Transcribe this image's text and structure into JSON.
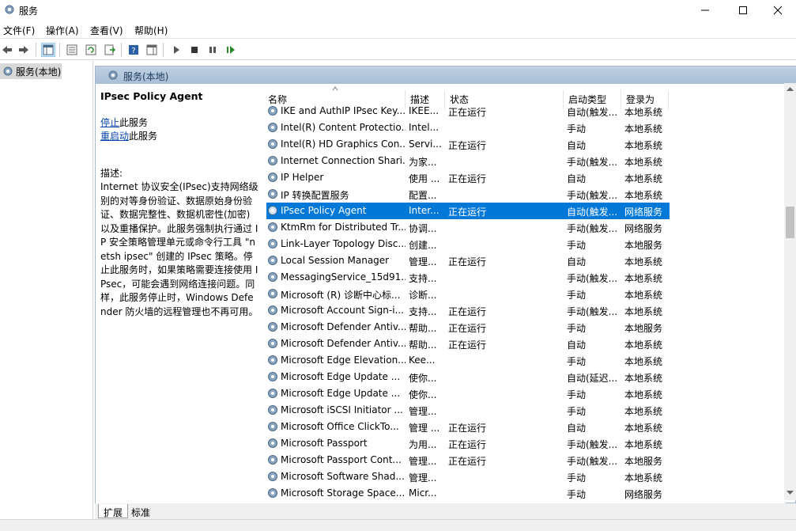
{
  "window": {
    "title": "服务"
  },
  "menu": [
    "文件(F)",
    "操作(A)",
    "查看(V)",
    "帮助(H)"
  ],
  "tree": {
    "item": "服务(本地)"
  },
  "header": {
    "title": "服务(本地)"
  },
  "description": {
    "service_name": "IPsec Policy Agent",
    "stop_link": "停止",
    "stop_suffix": "此服务",
    "restart_link": "重启动",
    "restart_suffix": "此服务",
    "desc_label": "描述:",
    "desc_text": "Internet 协议安全(IPsec)支持网络级别的对等身份验证、数据原始身份验证、数据完整性、数据机密性(加密)以及重播保护。此服务强制执行通过 IP 安全策略管理单元或命令行工具 \"netsh ipsec\" 创建的 IPsec 策略。停止此服务时，如果策略需要连接使用 IPsec，可能会遇到网络连接问题。同样，此服务停止时，Windows Defender 防火墙的远程管理也不再可用。"
  },
  "columns": [
    "名称",
    "描述",
    "状态",
    "启动类型",
    "登录为"
  ],
  "rows": [
    {
      "name": "IKE and AuthIP IPsec Key...",
      "desc": "IKEE...",
      "status": "正在运行",
      "startup": "自动(触发...",
      "logon": "本地系统"
    },
    {
      "name": "Intel(R) Content Protectio...",
      "desc": "Intel...",
      "status": "",
      "startup": "手动",
      "logon": "本地系统"
    },
    {
      "name": "Intel(R) HD Graphics Con...",
      "desc": "Servi...",
      "status": "正在运行",
      "startup": "自动",
      "logon": "本地系统"
    },
    {
      "name": "Internet Connection Shari...",
      "desc": "为家...",
      "status": "",
      "startup": "手动(触发...",
      "logon": "本地系统"
    },
    {
      "name": "IP Helper",
      "desc": "使用 ...",
      "status": "正在运行",
      "startup": "自动",
      "logon": "本地系统"
    },
    {
      "name": "IP 转换配置服务",
      "desc": "配置...",
      "status": "",
      "startup": "手动(触发...",
      "logon": "本地系统"
    },
    {
      "name": "IPsec Policy Agent",
      "desc": "Inter...",
      "status": "正在运行",
      "startup": "自动(触发...",
      "logon": "网络服务",
      "selected": true
    },
    {
      "name": "KtmRm for Distributed Tr...",
      "desc": "协调...",
      "status": "",
      "startup": "手动(触发...",
      "logon": "网络服务"
    },
    {
      "name": "Link-Layer Topology Disc...",
      "desc": "创建...",
      "status": "",
      "startup": "手动",
      "logon": "本地服务"
    },
    {
      "name": "Local Session Manager",
      "desc": "管理...",
      "status": "正在运行",
      "startup": "自动",
      "logon": "本地系统"
    },
    {
      "name": "MessagingService_15d91...",
      "desc": "支持...",
      "status": "",
      "startup": "手动(触发...",
      "logon": "本地系统"
    },
    {
      "name": "Microsoft (R) 诊断中心标...",
      "desc": "诊断...",
      "status": "",
      "startup": "手动",
      "logon": "本地系统"
    },
    {
      "name": "Microsoft Account Sign-i...",
      "desc": "支持...",
      "status": "正在运行",
      "startup": "手动(触发...",
      "logon": "本地系统"
    },
    {
      "name": "Microsoft Defender Antiv...",
      "desc": "帮助...",
      "status": "正在运行",
      "startup": "手动",
      "logon": "本地服务"
    },
    {
      "name": "Microsoft Defender Antiv...",
      "desc": "帮助...",
      "status": "正在运行",
      "startup": "自动",
      "logon": "本地系统"
    },
    {
      "name": "Microsoft Edge Elevation...",
      "desc": "Kee...",
      "status": "",
      "startup": "手动",
      "logon": "本地系统"
    },
    {
      "name": "Microsoft Edge Update ...",
      "desc": "使你...",
      "status": "",
      "startup": "自动(延迟...",
      "logon": "本地系统"
    },
    {
      "name": "Microsoft Edge Update ...",
      "desc": "使你...",
      "status": "",
      "startup": "手动",
      "logon": "本地系统"
    },
    {
      "name": "Microsoft iSCSI Initiator ...",
      "desc": "管理...",
      "status": "",
      "startup": "手动",
      "logon": "本地系统"
    },
    {
      "name": "Microsoft Office ClickTo...",
      "desc": "管理 ...",
      "status": "正在运行",
      "startup": "自动",
      "logon": "本地系统"
    },
    {
      "name": "Microsoft Passport",
      "desc": "为用...",
      "status": "正在运行",
      "startup": "手动(触发...",
      "logon": "本地系统"
    },
    {
      "name": "Microsoft Passport Cont...",
      "desc": "管理...",
      "status": "正在运行",
      "startup": "手动(触发...",
      "logon": "本地服务"
    },
    {
      "name": "Microsoft Software Shad...",
      "desc": "管理...",
      "status": "",
      "startup": "手动",
      "logon": "本地系统"
    },
    {
      "name": "Microsoft Storage Space...",
      "desc": "Micr...",
      "status": "",
      "startup": "手动",
      "logon": "网络服务"
    }
  ],
  "tabs": [
    "扩展",
    "标准"
  ],
  "colors": {
    "selection": "#0078d7",
    "header": "#bfd0e2",
    "link": "#0645ad"
  }
}
